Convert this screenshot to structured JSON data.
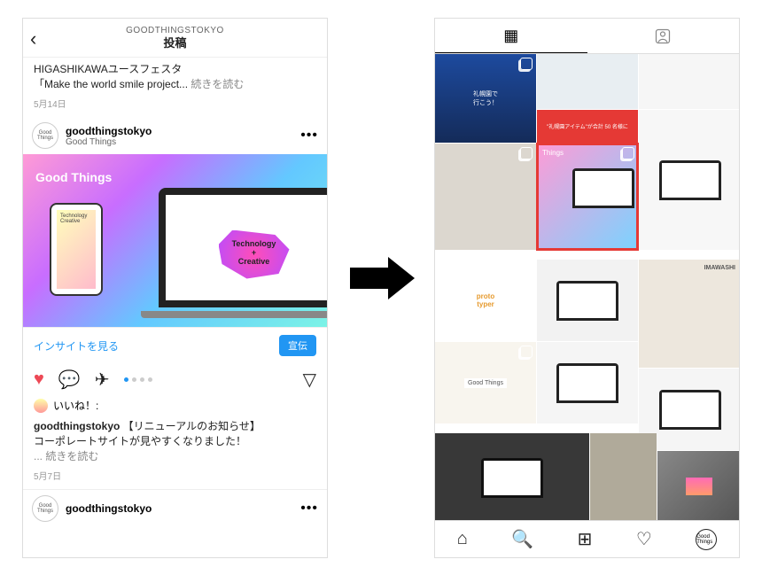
{
  "left": {
    "header": {
      "account": "GOODTHINGSTOKYO",
      "title": "投稿"
    },
    "prev": {
      "line1": "HIGASHIKAWAユースフェスタ",
      "line2": "「Make the world smile project...",
      "more": "続きを読む",
      "date": "5月14日"
    },
    "account": {
      "username": "goodthingstokyo",
      "subtitle": "Good Things",
      "avatar": "Good Things"
    },
    "hero": {
      "brand": "Good Things",
      "tech_line1": "Technology",
      "tech_plus": "+",
      "tech_line2": "Creative",
      "phone_label1": "Technology",
      "phone_label2": "Creative"
    },
    "insight": {
      "text": "インサイトを見る",
      "button": "宣伝"
    },
    "likes_label": "いいね！:",
    "caption": {
      "user": "goodthingstokyo",
      "title": "【リニューアルのお知らせ】",
      "body": "コーポレートサイトが見やすくなりました！",
      "more": "... 続きを読む",
      "date": "5月7日"
    },
    "next_account": {
      "username": "goodthingstokyo",
      "avatar": "Good Things"
    }
  },
  "right": {
    "tiles": {
      "t1": "礼幌園で\n行こう！",
      "t4": "\"礼幌園アイテム\"が合計 50 名様に",
      "t6_brand": "Things",
      "t8": "proto\ntyper",
      "t10": "IMAWASHI",
      "t11": "Good Things"
    },
    "bottom_profile": "Good Things"
  }
}
